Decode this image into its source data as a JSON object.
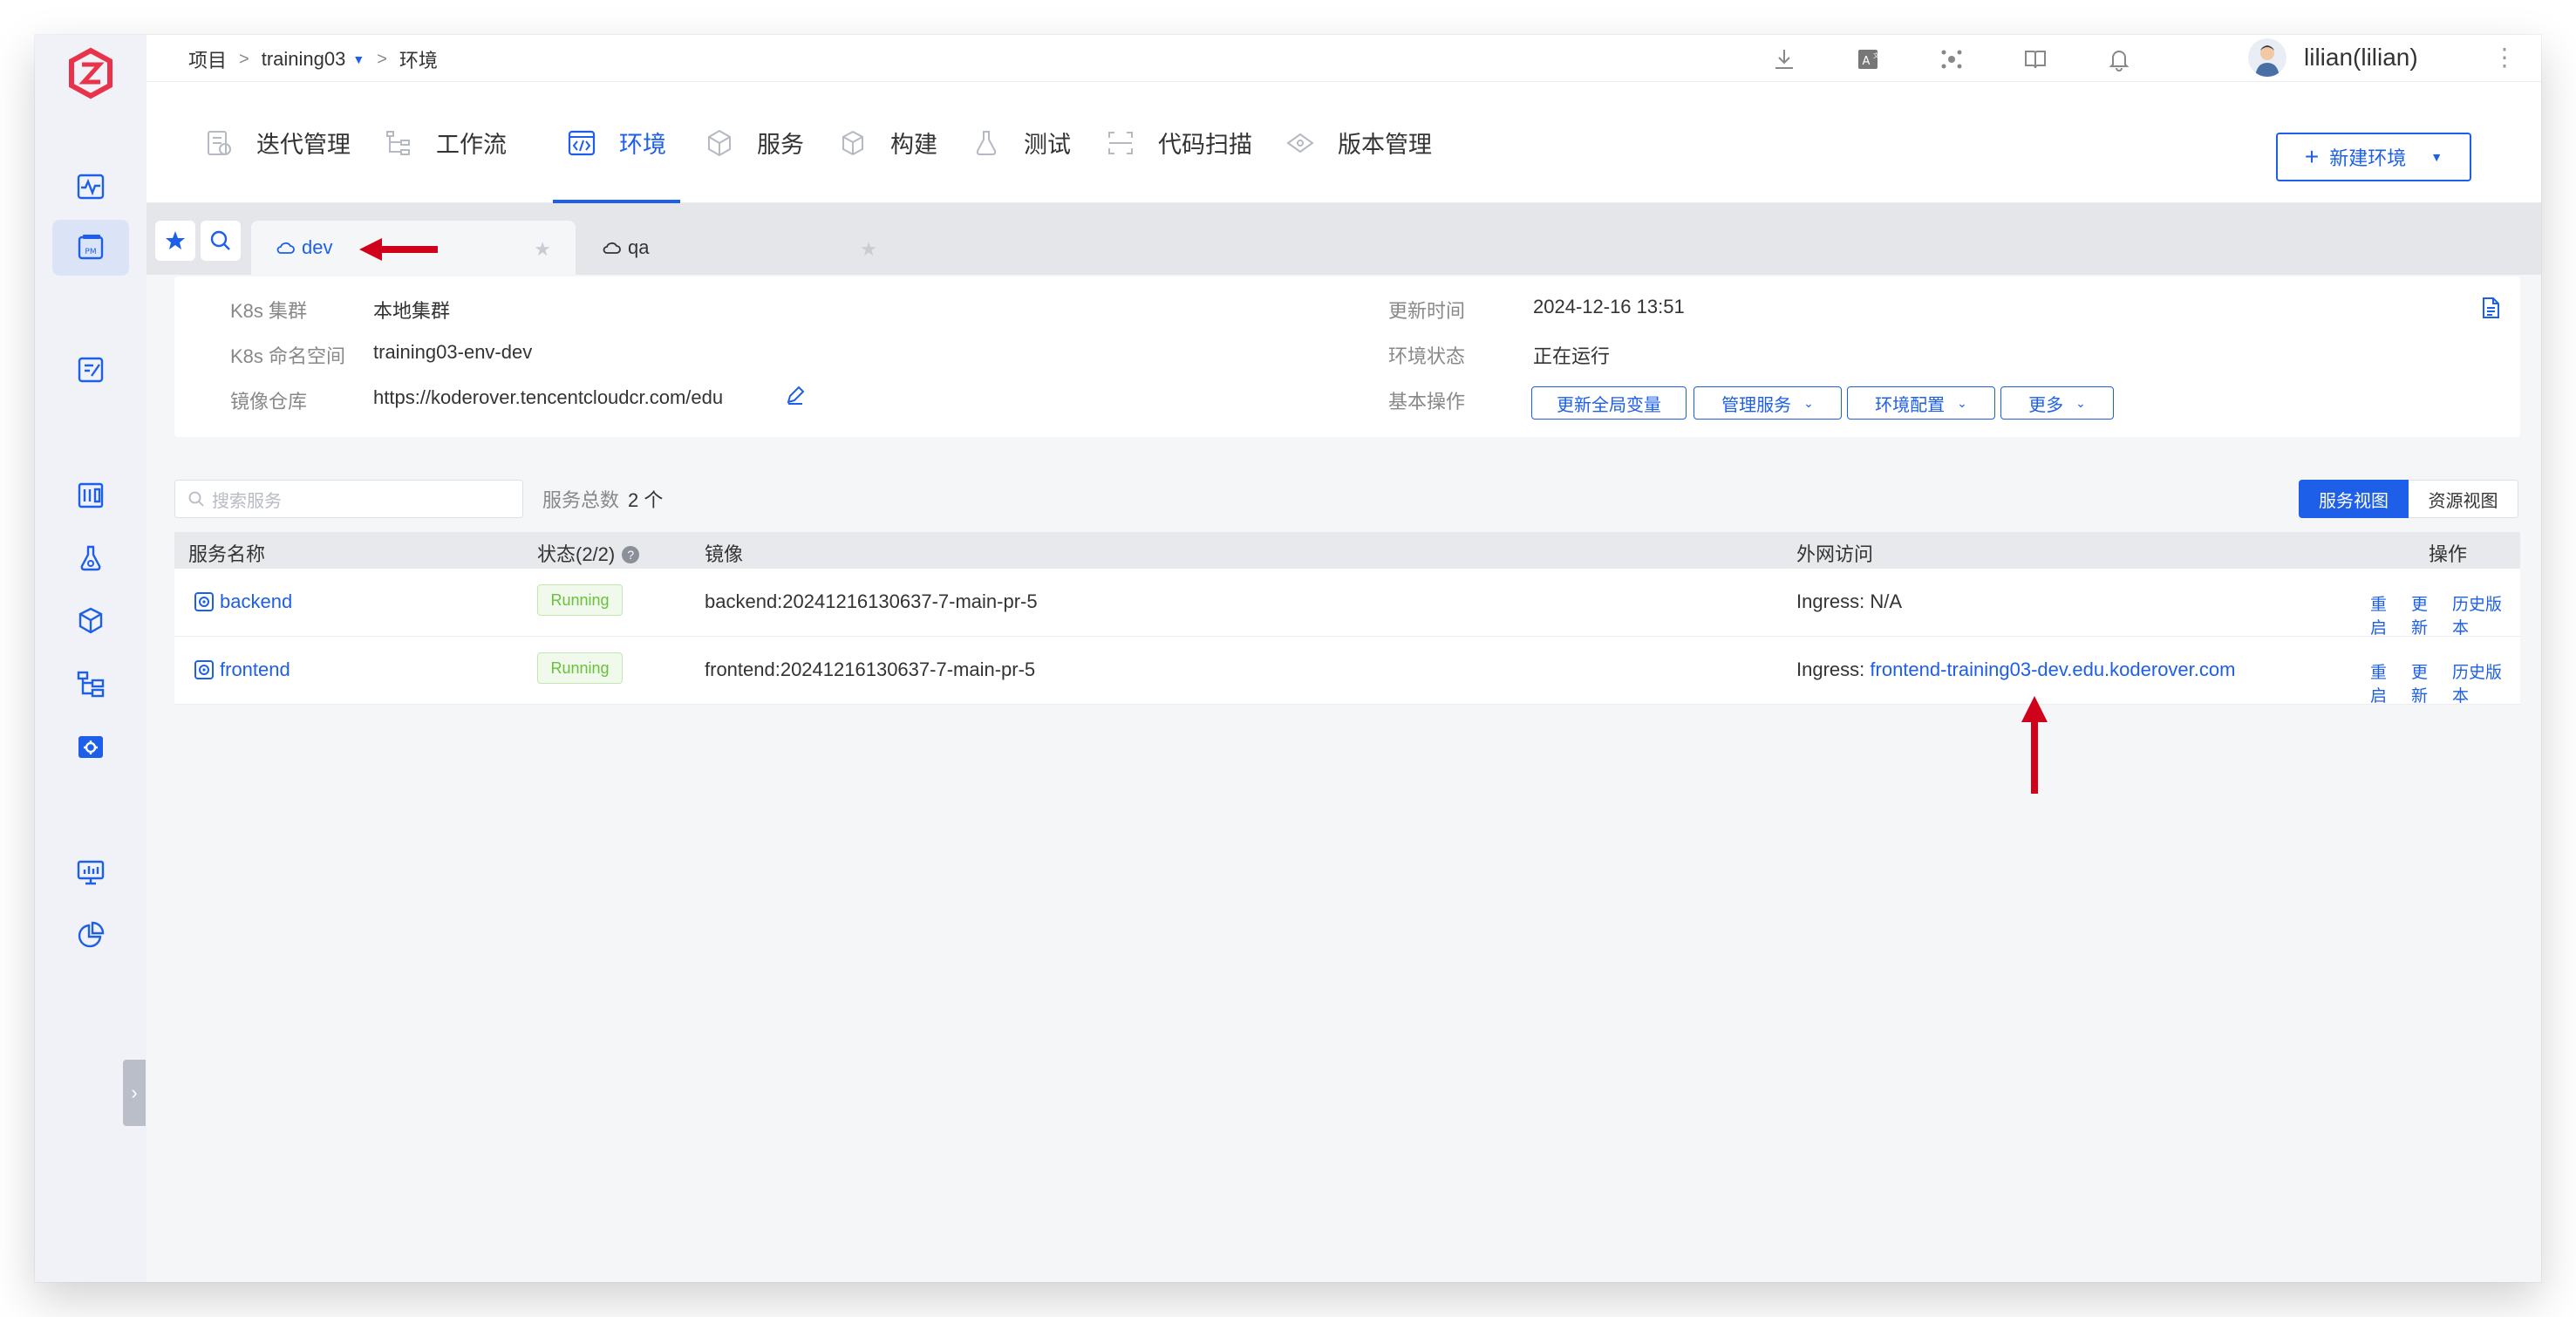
{
  "breadcrumb": {
    "root": "项目",
    "sep1": ">",
    "project": "training03",
    "sep2": ">",
    "current": "环境"
  },
  "user": {
    "name": "lilian(lilian)"
  },
  "top_icons": [
    "download-icon",
    "translate-icon",
    "integration-icon",
    "docs-icon",
    "bell-icon"
  ],
  "sidebar": {
    "items": [
      "activity-icon",
      "project-icon",
      "release-icon",
      "dashboard-icon",
      "flask-icon",
      "artifact-icon",
      "hierarchy-icon",
      "settings-icon",
      "monitor-icon",
      "pie-chart-icon"
    ]
  },
  "modules": [
    {
      "label": "迭代管理",
      "icon": "iteration-icon"
    },
    {
      "label": "工作流",
      "icon": "workflow-icon"
    },
    {
      "label": "环境",
      "icon": "code-icon"
    },
    {
      "label": "服务",
      "icon": "service-icon"
    },
    {
      "label": "构建",
      "icon": "build-icon"
    },
    {
      "label": "测试",
      "icon": "test-icon"
    },
    {
      "label": "代码扫描",
      "icon": "scan-icon"
    },
    {
      "label": "版本管理",
      "icon": "version-icon"
    }
  ],
  "new_env_label": "新建环境",
  "env_tabs": [
    {
      "label": "dev",
      "active": true
    },
    {
      "label": "qa",
      "active": false
    }
  ],
  "info": {
    "cluster_label": "K8s 集群",
    "cluster_value": "本地集群",
    "namespace_label": "K8s 命名空间",
    "namespace_value": "training03-env-dev",
    "registry_label": "镜像仓库",
    "registry_value": "https://koderover.tencentcloudcr.com/edu",
    "updated_label": "更新时间",
    "updated_value": "2024-12-16 13:51",
    "status_label": "环境状态",
    "status_value": "正在运行",
    "ops_label": "基本操作",
    "ops": [
      "更新全局变量",
      "管理服务",
      "环境配置",
      "更多"
    ]
  },
  "services_toolbar": {
    "search_placeholder": "搜索服务",
    "count_label": "服务总数",
    "count_value": "2 个",
    "view_service": "服务视图",
    "view_resource": "资源视图"
  },
  "table": {
    "headers": {
      "name": "服务名称",
      "status": "状态(2/2)",
      "image": "镜像",
      "ingress": "外网访问",
      "actions": "操作"
    },
    "rows": [
      {
        "name": "backend",
        "status": "Running",
        "image": "backend:20241216130637-7-main-pr-5",
        "ingress_prefix": "Ingress:",
        "ingress_value": "N/A",
        "ingress_is_link": false
      },
      {
        "name": "frontend",
        "status": "Running",
        "image": "frontend:20241216130637-7-main-pr-5",
        "ingress_prefix": "Ingress:",
        "ingress_value": "frontend-training03-dev.edu.koderover.com",
        "ingress_is_link": true
      }
    ],
    "row_actions": [
      "重启",
      "更新",
      "历史版本"
    ]
  },
  "colors": {
    "primary": "#1d5fe8",
    "running_green": "#67c23a",
    "annotation_red": "#d0021b"
  }
}
